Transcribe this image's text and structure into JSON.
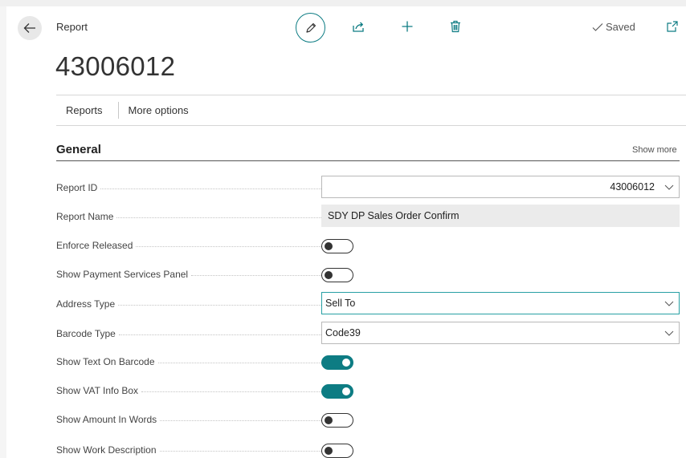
{
  "header": {
    "caption": "Report",
    "title": "43006012",
    "saved_label": "Saved"
  },
  "actions": [
    {
      "label": "Reports"
    },
    {
      "label": "More options"
    }
  ],
  "section": {
    "title": "General",
    "show_more": "Show more"
  },
  "fields": {
    "report_id": {
      "label": "Report ID",
      "value": "43006012"
    },
    "report_name": {
      "label": "Report Name",
      "value": "SDY DP Sales Order Confirm"
    },
    "enforce_released": {
      "label": "Enforce Released",
      "on": false
    },
    "show_payment_services_panel": {
      "label": "Show Payment Services Panel",
      "on": false
    },
    "address_type": {
      "label": "Address Type",
      "value": "Sell To"
    },
    "barcode_type": {
      "label": "Barcode Type",
      "value": "Code39"
    },
    "show_text_on_barcode": {
      "label": "Show Text On Barcode",
      "on": true
    },
    "show_vat_info_box": {
      "label": "Show VAT Info Box",
      "on": true
    },
    "show_amount_in_words": {
      "label": "Show Amount In Words",
      "on": false
    },
    "show_work_description": {
      "label": "Show Work Description",
      "on": false
    }
  },
  "colors": {
    "accent": "#0d7c83",
    "focus_border": "#27a0a4"
  },
  "icons": [
    "back-arrow-icon",
    "pencil-icon",
    "share-icon",
    "plus-icon",
    "trash-icon",
    "checkmark-icon",
    "pop-out-icon",
    "chevron-down-icon"
  ]
}
